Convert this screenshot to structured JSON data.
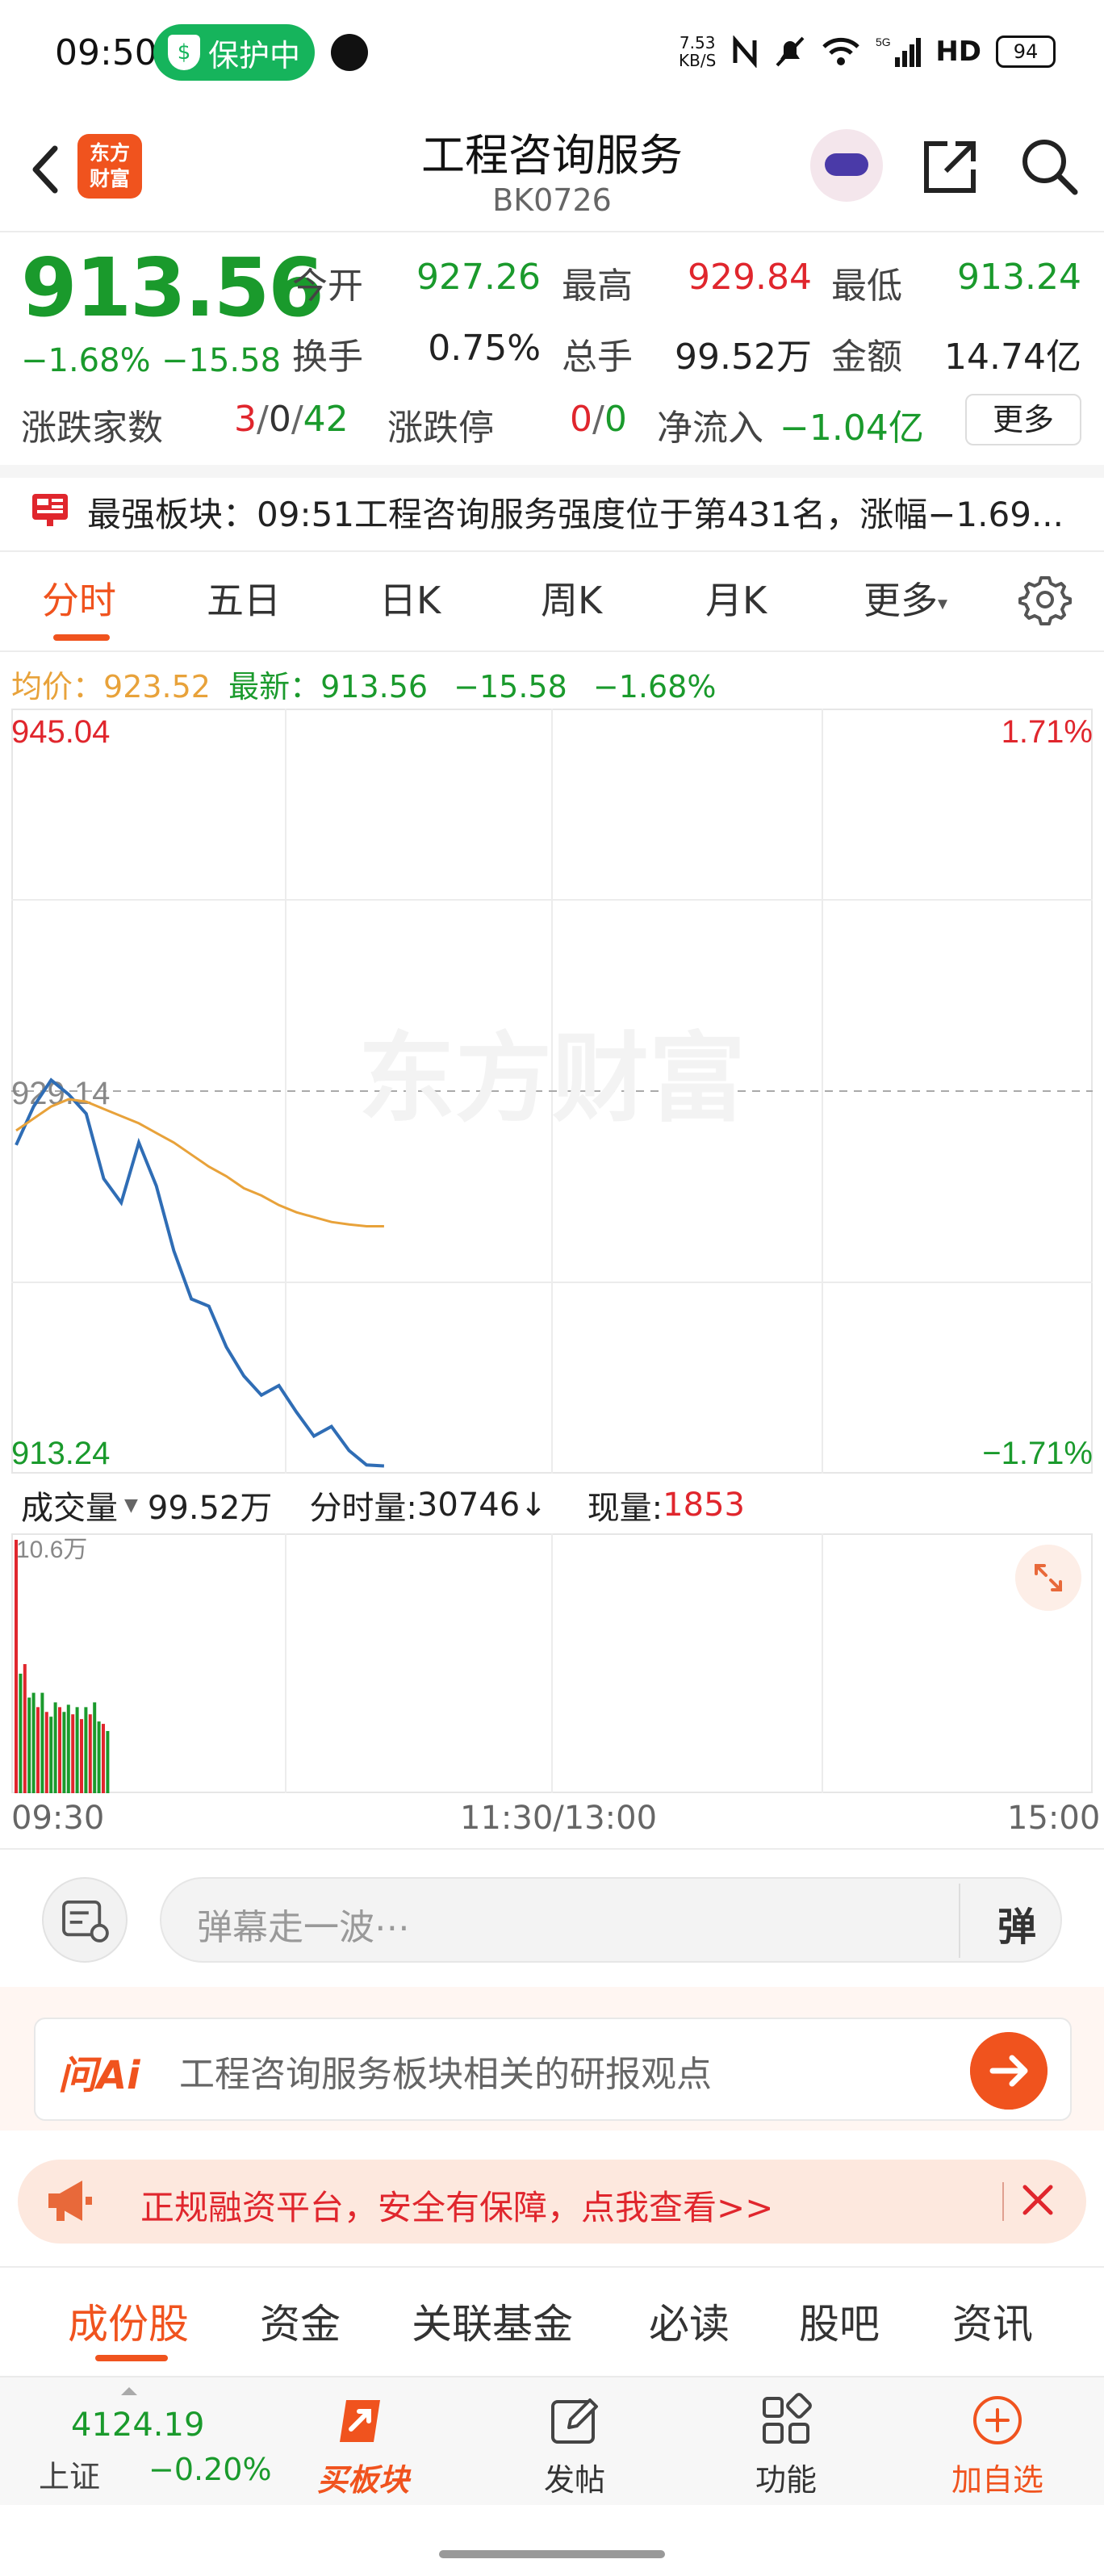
{
  "status_bar": {
    "time": "09:50",
    "protect_label": "保护中",
    "net_speed_value": "7.53",
    "net_speed_unit": "KB/S",
    "signal_text": "5G",
    "hd_text": "HD",
    "battery": "94"
  },
  "header": {
    "logo_text_line1": "东方",
    "logo_text_line2": "财富",
    "title": "工程咨询服务",
    "code": "BK0726"
  },
  "quote": {
    "price": "913.56",
    "change_pct": "−1.68%",
    "change_val": "−15.58",
    "open_label": "今开",
    "open_value": "927.26",
    "high_label": "最高",
    "high_value": "929.84",
    "low_label": "最低",
    "low_value": "913.24",
    "turnover_label": "换手",
    "turnover_value": "0.75%",
    "volume_label": "总手",
    "volume_value": "99.52万",
    "amount_label": "金额",
    "amount_value": "14.74亿",
    "breadth_label": "涨跌家数",
    "breadth_up": "3",
    "breadth_flat": "0",
    "breadth_down": "42",
    "limit_label": "涨跌停",
    "limit_up": "0",
    "limit_down": "0",
    "slash": "/",
    "netflow_label": "净流入",
    "netflow_value": "−1.04亿",
    "more_label": "更多"
  },
  "banner": {
    "text": "最强板块：09:51工程咨询服务强度位于第431名，涨幅−1.69..."
  },
  "period_tabs": [
    "分时",
    "五日",
    "日K",
    "周K",
    "月K",
    "更多"
  ],
  "avg_line": {
    "avg_label": "均价：",
    "avg_value": "923.52",
    "latest_label": "最新：",
    "latest_value": "913.56",
    "latest_chg": "−15.58",
    "latest_pct": "−1.68%"
  },
  "chart_labels": {
    "top_price": "945.04",
    "top_pct": "1.71%",
    "mid_price": "929.14",
    "bottom_price": "913.24",
    "bottom_pct": "−1.71%",
    "watermark": "东方财富"
  },
  "volume": {
    "selector_label": "成交量",
    "total": "99.52万",
    "tick_label": "分时量:",
    "tick_value": "30746",
    "tick_arrow": "↓",
    "now_label": "现量:",
    "now_value": "1853",
    "axis_max": "10.6万"
  },
  "time_axis": [
    "09:30",
    "11:30/13:00",
    "15:00"
  ],
  "comment": {
    "placeholder": "弹幕走一波⋯",
    "danmu_button": "弹"
  },
  "ai": {
    "logo": "问Ai",
    "text": "工程咨询服务板块相关的研报观点"
  },
  "promo": {
    "text": "正规融资平台，安全有保障，点我查看>>"
  },
  "bottom_tabs": [
    "成份股",
    "资金",
    "关联基金",
    "必读",
    "股吧",
    "资讯"
  ],
  "navbar": {
    "index_value": "4124.19",
    "index_name": "上证",
    "index_pct": "−0.20%",
    "buy_label": "买板块",
    "post_label": "发帖",
    "func_label": "功能",
    "add_label": "加自选"
  },
  "colors": {
    "up": "#e0262d",
    "down": "#1a9a2c",
    "brand": "#f0531e",
    "price_line": "#2f6db5",
    "avg_line": "#e8a23a"
  },
  "chart_data": {
    "type": "line",
    "title": "",
    "xlabel": "",
    "ylabel": "",
    "ylim": [
      913.24,
      945.04
    ],
    "reference": 929.14,
    "x": [
      0,
      1,
      2,
      3,
      4,
      5,
      6,
      7,
      8,
      9,
      10,
      11,
      12,
      13,
      14,
      15,
      16,
      17,
      18,
      19,
      20,
      21
    ],
    "series": [
      {
        "name": "",
        "values": [
          926.9,
          928.5,
          929.6,
          929.0,
          928.2,
          925.5,
          924.5,
          927.0,
          925.2,
          922.5,
          920.5,
          920.2,
          918.5,
          917.3,
          916.5,
          916.9,
          915.8,
          914.8,
          915.2,
          914.2,
          913.6,
          913.56
        ]
      },
      {
        "name": "",
        "values": [
          927.5,
          928.0,
          928.5,
          928.8,
          928.7,
          928.4,
          928.1,
          927.8,
          927.4,
          927.0,
          926.5,
          926.0,
          925.6,
          925.1,
          924.8,
          924.4,
          924.1,
          923.9,
          923.7,
          923.6,
          923.52,
          923.52
        ]
      }
    ],
    "volume": {
      "max": 106000,
      "values": [
        106000,
        50000,
        54000,
        40000,
        42000,
        36000,
        42000,
        34000,
        32000,
        38000,
        36000,
        34000,
        37000,
        33000,
        36000,
        31000,
        36000,
        33000,
        38000,
        30000,
        29000,
        26000
      ],
      "colors": [
        "up",
        "down",
        "up",
        "down",
        "down",
        "up",
        "down",
        "up",
        "down",
        "down",
        "up",
        "down",
        "down",
        "up",
        "down",
        "up",
        "down",
        "up",
        "down",
        "down",
        "up",
        "down"
      ]
    }
  }
}
